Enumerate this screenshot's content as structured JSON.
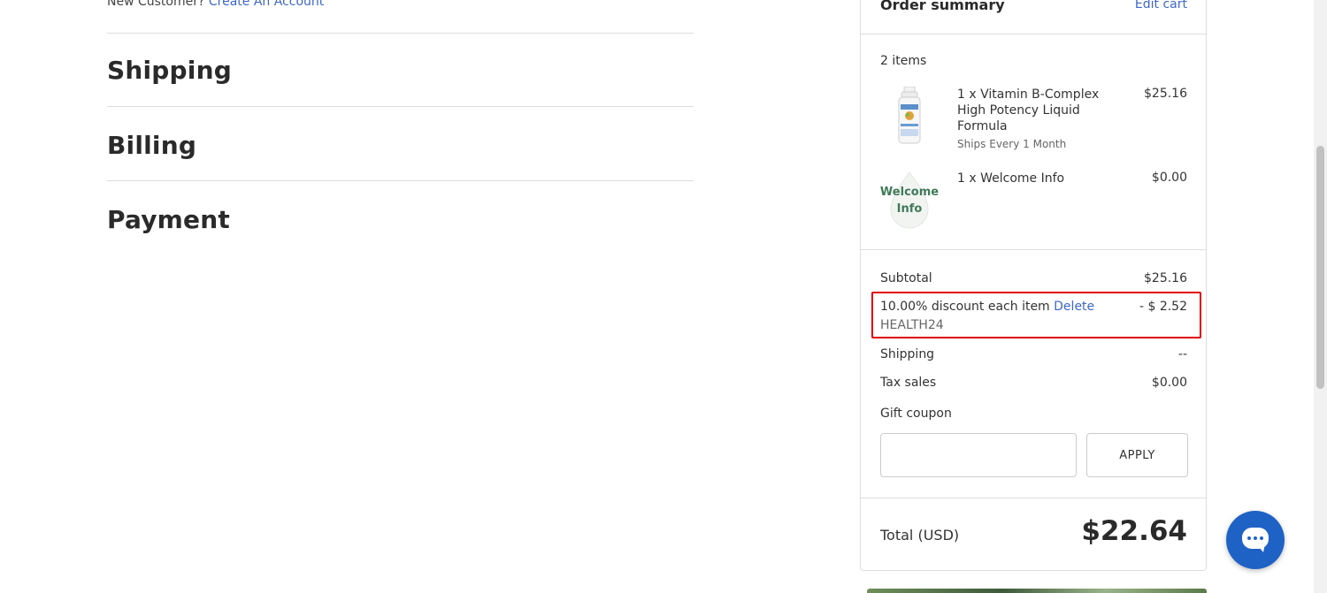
{
  "checkout": {
    "new_customer_text": "New Customer?",
    "create_account_link": "Create An Account",
    "sections": [
      "Shipping",
      "Billing",
      "Payment"
    ]
  },
  "order_summary": {
    "title": "Order summary",
    "edit_cart": "Edit cart",
    "items_count": "2 items",
    "items": [
      {
        "name": "1 x Vitamin B-Complex High Potency Liquid Formula",
        "note": "Ships Every 1 Month",
        "price": "$25.16",
        "thumb_icon": "supplement-bottle-image"
      },
      {
        "name": "1 x Welcome Info",
        "thumb_text_1": "Welcome",
        "thumb_text_2": "Info",
        "price": "$0.00",
        "thumb_icon": "welcome-info-image"
      }
    ],
    "subtotal_label": "Subtotal",
    "subtotal_value": "$25.16",
    "discount_label": "10.00% discount each item",
    "discount_delete": "Delete",
    "discount_value": "- $ 2.52",
    "coupon_code": "HEALTH24",
    "shipping_label": "Shipping",
    "shipping_value": "--",
    "tax_label": "Tax sales",
    "tax_value": "$0.00",
    "gift_coupon_label": "Gift coupon",
    "gift_coupon_input_value": "",
    "apply_button": "APPLY",
    "total_label": "Total (USD)",
    "total_value": "$22.64"
  },
  "colors": {
    "link": "#3e67c9",
    "highlight": "#e00000",
    "chat_button": "#1f62c6"
  },
  "chat": {
    "icon": "chat-bubble-icon"
  }
}
